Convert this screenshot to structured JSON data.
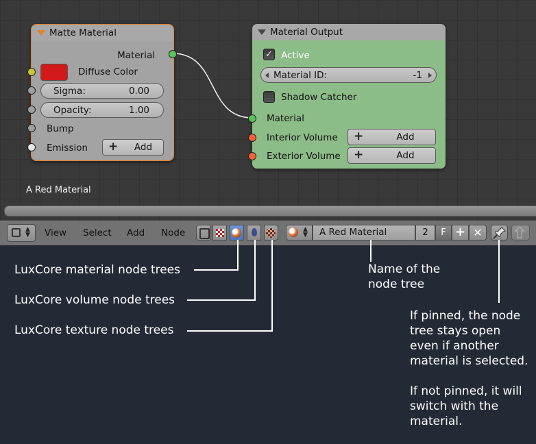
{
  "matte_node": {
    "title": "Matte Material",
    "output_label": "Material",
    "diffuse_label": "Diffuse Color",
    "diffuse_color": "#d21a1a",
    "sigma_label": "Sigma:",
    "sigma_value": "0.00",
    "opacity_label": "Opacity:",
    "opacity_value": "1.00",
    "bump_label": "Bump",
    "emission_label": "Emission",
    "add_label": "Add"
  },
  "output_node": {
    "title": "Material Output",
    "active_label": "Active",
    "active_checked": true,
    "material_id_label": "Material ID:",
    "material_id_value": "-1",
    "shadow_catcher_label": "Shadow Catcher",
    "shadow_catcher_checked": false,
    "material_input_label": "Material",
    "interior_label": "Interior Volume",
    "exterior_label": "Exterior Volume",
    "add_label": "Add",
    "body_color": "#8cbc87"
  },
  "tree_name_label": "A Red Material",
  "header": {
    "menus": [
      "View",
      "Select",
      "Add",
      "Node"
    ],
    "tree_name": "A Red Material",
    "users_count": "2",
    "fake_user": "F"
  },
  "annotations": {
    "material_trees": "LuxCore material node trees",
    "volume_trees": "LuxCore volume node trees",
    "texture_trees": "LuxCore texture node trees",
    "name_of_tree": "Name of the\nnode tree",
    "pin_note": "If pinned, the node\ntree stays open\neven if another\nmaterial is selected.\n\nIf not pinned, it will\nswitch with the\nmaterial."
  },
  "colors": {
    "socket_green": "#5ac25a",
    "socket_orange": "#f0643a",
    "socket_yellow": "#c8c83a",
    "socket_grey": "#a0a0a0",
    "node_selected_border": "#e0802e",
    "accent_blue": "#5582c8"
  }
}
